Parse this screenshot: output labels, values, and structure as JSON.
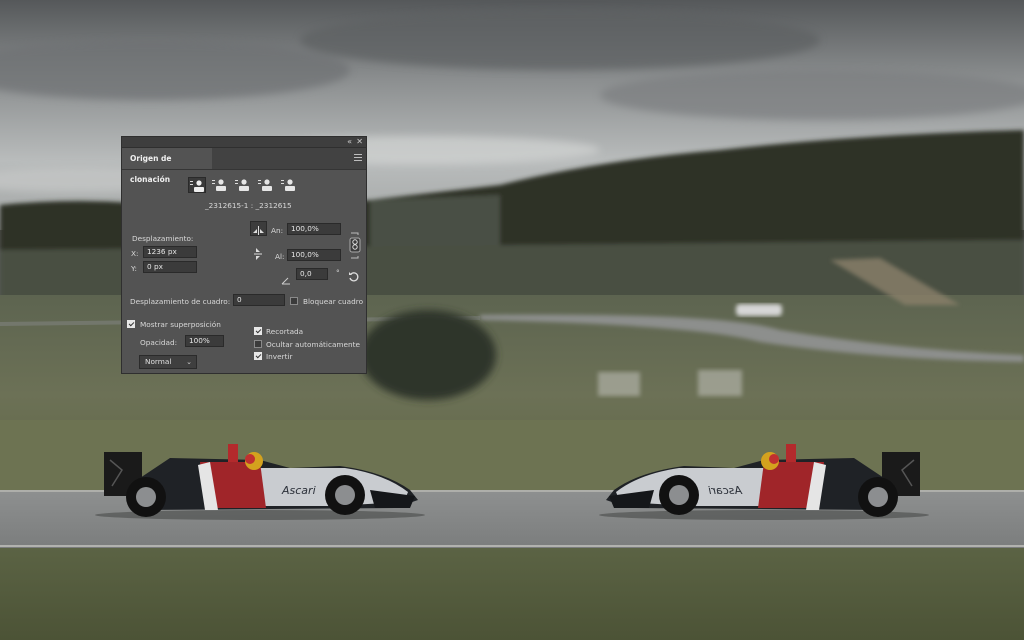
{
  "panel": {
    "tab_label": "Origen de clonación",
    "source_name": "_2312615-1 : _2312615",
    "offset_heading": "Desplazamiento:",
    "x_label": "X:",
    "x_value": "1236 px",
    "y_label": "Y:",
    "y_value": "0 px",
    "width_label": "An:",
    "width_value": "100,0%",
    "height_label": "Al:",
    "height_value": "100,0%",
    "angle_value": "0,0",
    "angle_unit": "°",
    "frame_offset_label": "Desplazamiento de cuadro:",
    "frame_offset_value": "0",
    "lock_frame_label": "Bloquear cuadro",
    "lock_frame_checked": false,
    "show_overlay_label": "Mostrar superposición",
    "show_overlay_checked": true,
    "opacity_label": "Opacidad:",
    "opacity_value": "100%",
    "clipped_label": "Recortada",
    "clipped_checked": true,
    "auto_hide_label": "Ocultar automáticamente",
    "auto_hide_checked": false,
    "invert_label": "Invertir",
    "invert_checked": true,
    "blend_mode": "Normal",
    "panel_bg_color": "#535353"
  },
  "photo": {
    "car_livery_text": "Ascari",
    "car_livery_text_mirrored": "Ascari"
  }
}
